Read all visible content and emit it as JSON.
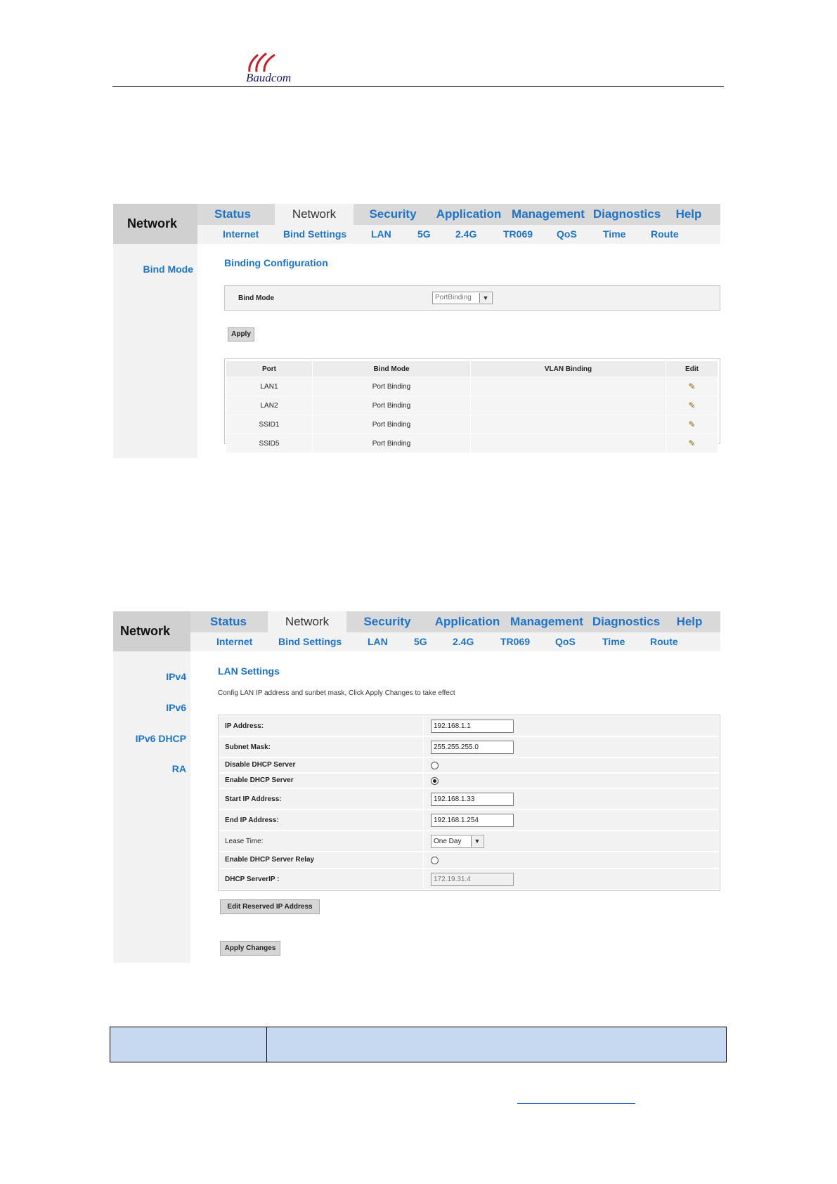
{
  "logo": {
    "text": "Baudcom"
  },
  "shared_nav": {
    "brand": "Network",
    "tabs": [
      "Status",
      "Network",
      "Security",
      "Application",
      "Management",
      "Diagnostics",
      "Help"
    ],
    "active_tab": "Network",
    "subtabs": [
      "Internet",
      "Bind Settings",
      "LAN",
      "5G",
      "2.4G",
      "TR069",
      "QoS",
      "Time",
      "Route"
    ]
  },
  "panel1": {
    "side_items": [
      "Bind Mode"
    ],
    "section_title": "Binding Configuration",
    "bind_mode_label": "Bind Mode",
    "bind_mode_value": "PortBinding",
    "apply_label": "Apply",
    "table": {
      "headers": [
        "Port",
        "Bind Mode",
        "VLAN Binding",
        "Edit"
      ],
      "rows": [
        [
          "LAN1",
          "Port Binding",
          ""
        ],
        [
          "LAN2",
          "Port Binding",
          ""
        ],
        [
          "SSID1",
          "Port Binding",
          ""
        ],
        [
          "SSID5",
          "Port Binding",
          ""
        ]
      ]
    }
  },
  "panel2": {
    "side_items": [
      "IPv4",
      "IPv6",
      "IPv6 DHCP",
      "RA"
    ],
    "section_title": "LAN Settings",
    "description": "Config LAN IP address and sunbet mask, Click Apply Changes to take effect",
    "rows": {
      "ip_address": {
        "label": "IP Address:",
        "value": "192.168.1.1"
      },
      "subnet_mask": {
        "label": "Subnet Mask:",
        "value": "255.255.255.0"
      },
      "disable_dhcp": {
        "label": "Disable DHCP Server"
      },
      "enable_dhcp": {
        "label": "Enable DHCP Server"
      },
      "start_ip": {
        "label": "Start IP Address:",
        "value": "192.168.1.33"
      },
      "end_ip": {
        "label": "End IP Address:",
        "value": "192.168.1.254"
      },
      "lease_time": {
        "label": "Lease Time:",
        "value": "One Day"
      },
      "dhcp_relay": {
        "label": "Enable DHCP Server Relay"
      },
      "dhcp_server_ip": {
        "label": "DHCP ServerIP :",
        "value": "172.19.31.4"
      }
    },
    "edit_reserved_label": "Edit Reserved IP  Address",
    "apply_changes_label": "Apply Changes"
  },
  "icons": {
    "edit": "pencil-icon",
    "dropdown": "chevron-down-icon"
  },
  "colors": {
    "accent": "#1e73c8",
    "nav_band": "#d9d9d9",
    "table_fill": "#c6d9f1"
  }
}
